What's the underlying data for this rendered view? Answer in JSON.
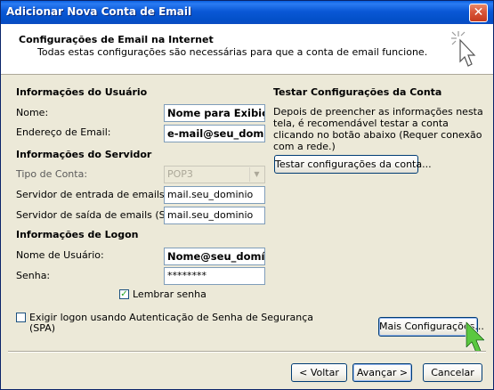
{
  "window": {
    "title": "Adicionar Nova Conta de Email",
    "close_label": "✕"
  },
  "header": {
    "title": "Configurações de Email na Internet",
    "subtitle": "Todas estas configurações são necessárias para que a conta de email funcione."
  },
  "user_info": {
    "heading": "Informações do Usuário",
    "name_label": "Nome:",
    "name_value": "Nome para Exibição",
    "email_label": "Endereço de Email:",
    "email_value": "e-mail@seu_domínio"
  },
  "server_info": {
    "heading": "Informações do Servidor",
    "account_type_label": "Tipo de Conta:",
    "account_type_value": "POP3",
    "incoming_label": "Servidor de entrada de emails:",
    "incoming_value": "mail.seu_dominio",
    "outgoing_label": "Servidor de saída de emails (SMTP):",
    "outgoing_value": "mail.seu_dominio"
  },
  "logon_info": {
    "heading": "Informações de Logon",
    "username_label": "Nome de Usuário:",
    "username_value": "Nome@seu_domínio",
    "password_label": "Senha:",
    "password_value": "********",
    "remember_label": "Lembrar senha",
    "remember_checked": true,
    "spa_label_line1": "Exigir logon usando Autenticação de Senha de Segurança",
    "spa_label_line2": "(SPA)",
    "spa_checked": false
  },
  "test": {
    "heading": "Testar Configurações da Conta",
    "description": "Depois de preencher as informações nesta tela, é recomendável testar a conta clicando no botão abaixo (Requer conexão com a rede.)",
    "button_label": "Testar configurações da conta..."
  },
  "buttons": {
    "more_settings": "Mais Configurações...",
    "back": "< Voltar",
    "next": "Avançar >",
    "cancel": "Cancelar"
  },
  "colors": {
    "title_bar": "#0a58d6",
    "dialog_bg": "#ece9d8",
    "close_button": "#d9563a",
    "check_mark": "#21a121"
  }
}
